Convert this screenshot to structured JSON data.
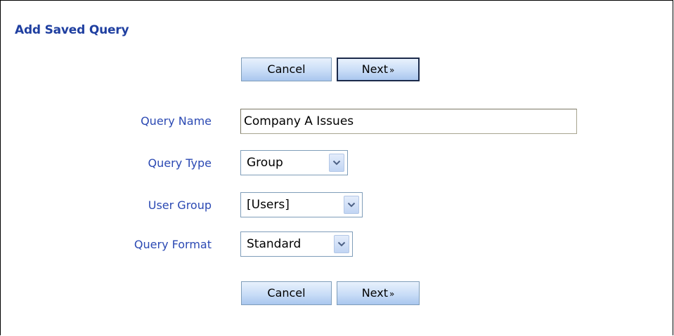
{
  "page_title": "Add Saved Query",
  "buttons": {
    "cancel_label": "Cancel",
    "next_label": "Next",
    "next_chevron": "»"
  },
  "form": {
    "query_name": {
      "label": "Query Name",
      "value": "Company A Issues"
    },
    "query_type": {
      "label": "Query Type",
      "value": "Group"
    },
    "user_group": {
      "label": "User Group",
      "value": "[Users]"
    },
    "query_format": {
      "label": "Query Format",
      "value": "Standard"
    }
  },
  "icons": {
    "dropdown": "chevron-down-icon"
  },
  "colors": {
    "title": "#1f3fa0",
    "label": "#2b49b3",
    "button_top": "#e8f1fc",
    "button_bottom": "#a9c6ee",
    "button_border": "#7f9db9",
    "focused_button_border": "#1b2a4a"
  }
}
